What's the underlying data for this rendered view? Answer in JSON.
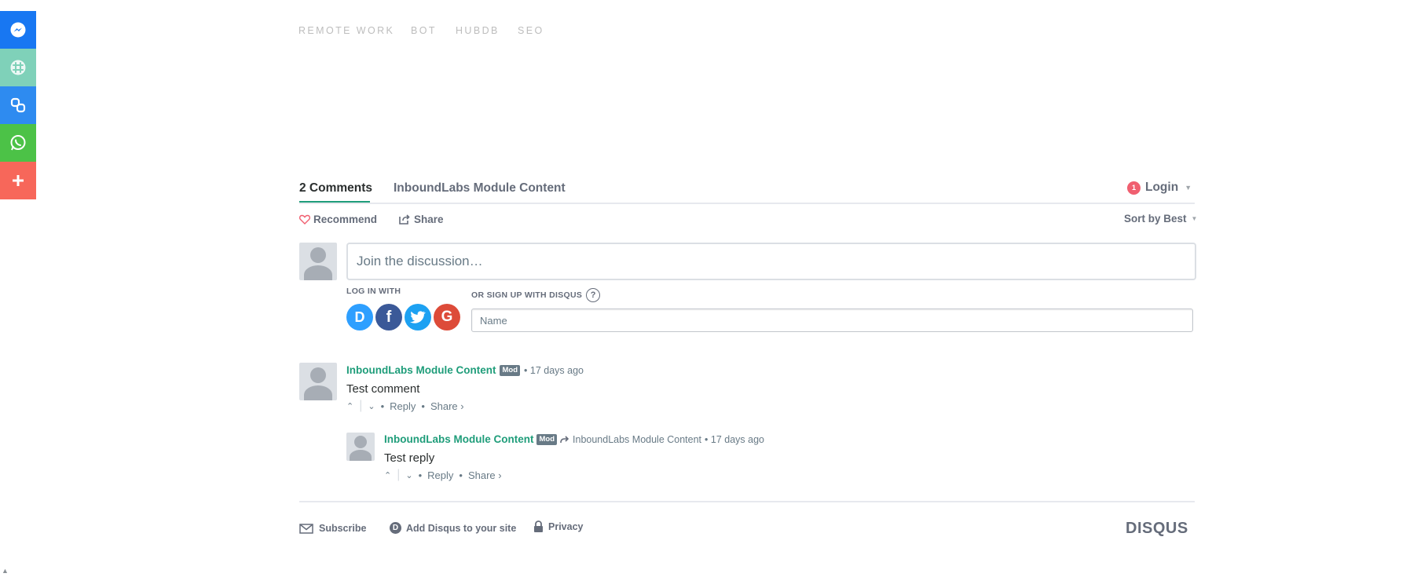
{
  "share_sidebar": [
    {
      "icon": "messenger-icon",
      "color": "#1877f2"
    },
    {
      "icon": "slack-icon",
      "color": "#7fd1b9"
    },
    {
      "icon": "copy-link-icon",
      "color": "#2e8bf0"
    },
    {
      "icon": "whatsapp-icon",
      "color": "#4cc247"
    },
    {
      "icon": "plus-icon",
      "color": "#f7675a"
    }
  ],
  "tags": [
    "REMOTE WORK",
    "BOT",
    "HUBDB",
    "SEO"
  ],
  "disqus": {
    "tabs": {
      "comments": "2 Comments",
      "community": "InboundLabs Module Content"
    },
    "login": {
      "badge": "1",
      "label": "Login"
    },
    "recommend": "Recommend",
    "share": "Share",
    "sort": "Sort by Best",
    "composer_placeholder": "Join the discussion…",
    "log_in_with": "LOG IN WITH",
    "sign_up": "OR SIGN UP WITH DISQUS",
    "help": "?",
    "name_placeholder": "Name",
    "social": [
      {
        "icon": "disqus-d-icon",
        "letter": "D",
        "color": "#2e9fff"
      },
      {
        "icon": "facebook-icon",
        "letter": "f",
        "color": "#3b5998"
      },
      {
        "icon": "twitter-icon",
        "letter": "",
        "color": "#1da1f2"
      },
      {
        "icon": "google-icon",
        "letter": "G",
        "color": "#dd4b39"
      }
    ],
    "comments": [
      {
        "author": "InboundLabs Module Content",
        "badge": "Mod",
        "time": "• 17 days ago",
        "text": "Test comment",
        "reply": "Reply",
        "share": "Share ›"
      }
    ],
    "reply": {
      "author": "InboundLabs Module Content",
      "badge": "Mod",
      "in_reply_to": "InboundLabs Module Content",
      "time": "• 17 days ago",
      "text": "Test reply",
      "reply": "Reply",
      "share": "Share ›"
    },
    "footer": {
      "subscribe": "Subscribe",
      "add_disqus": "Add Disqus to your site",
      "privacy": "Privacy",
      "brand": "DISQUS"
    }
  }
}
